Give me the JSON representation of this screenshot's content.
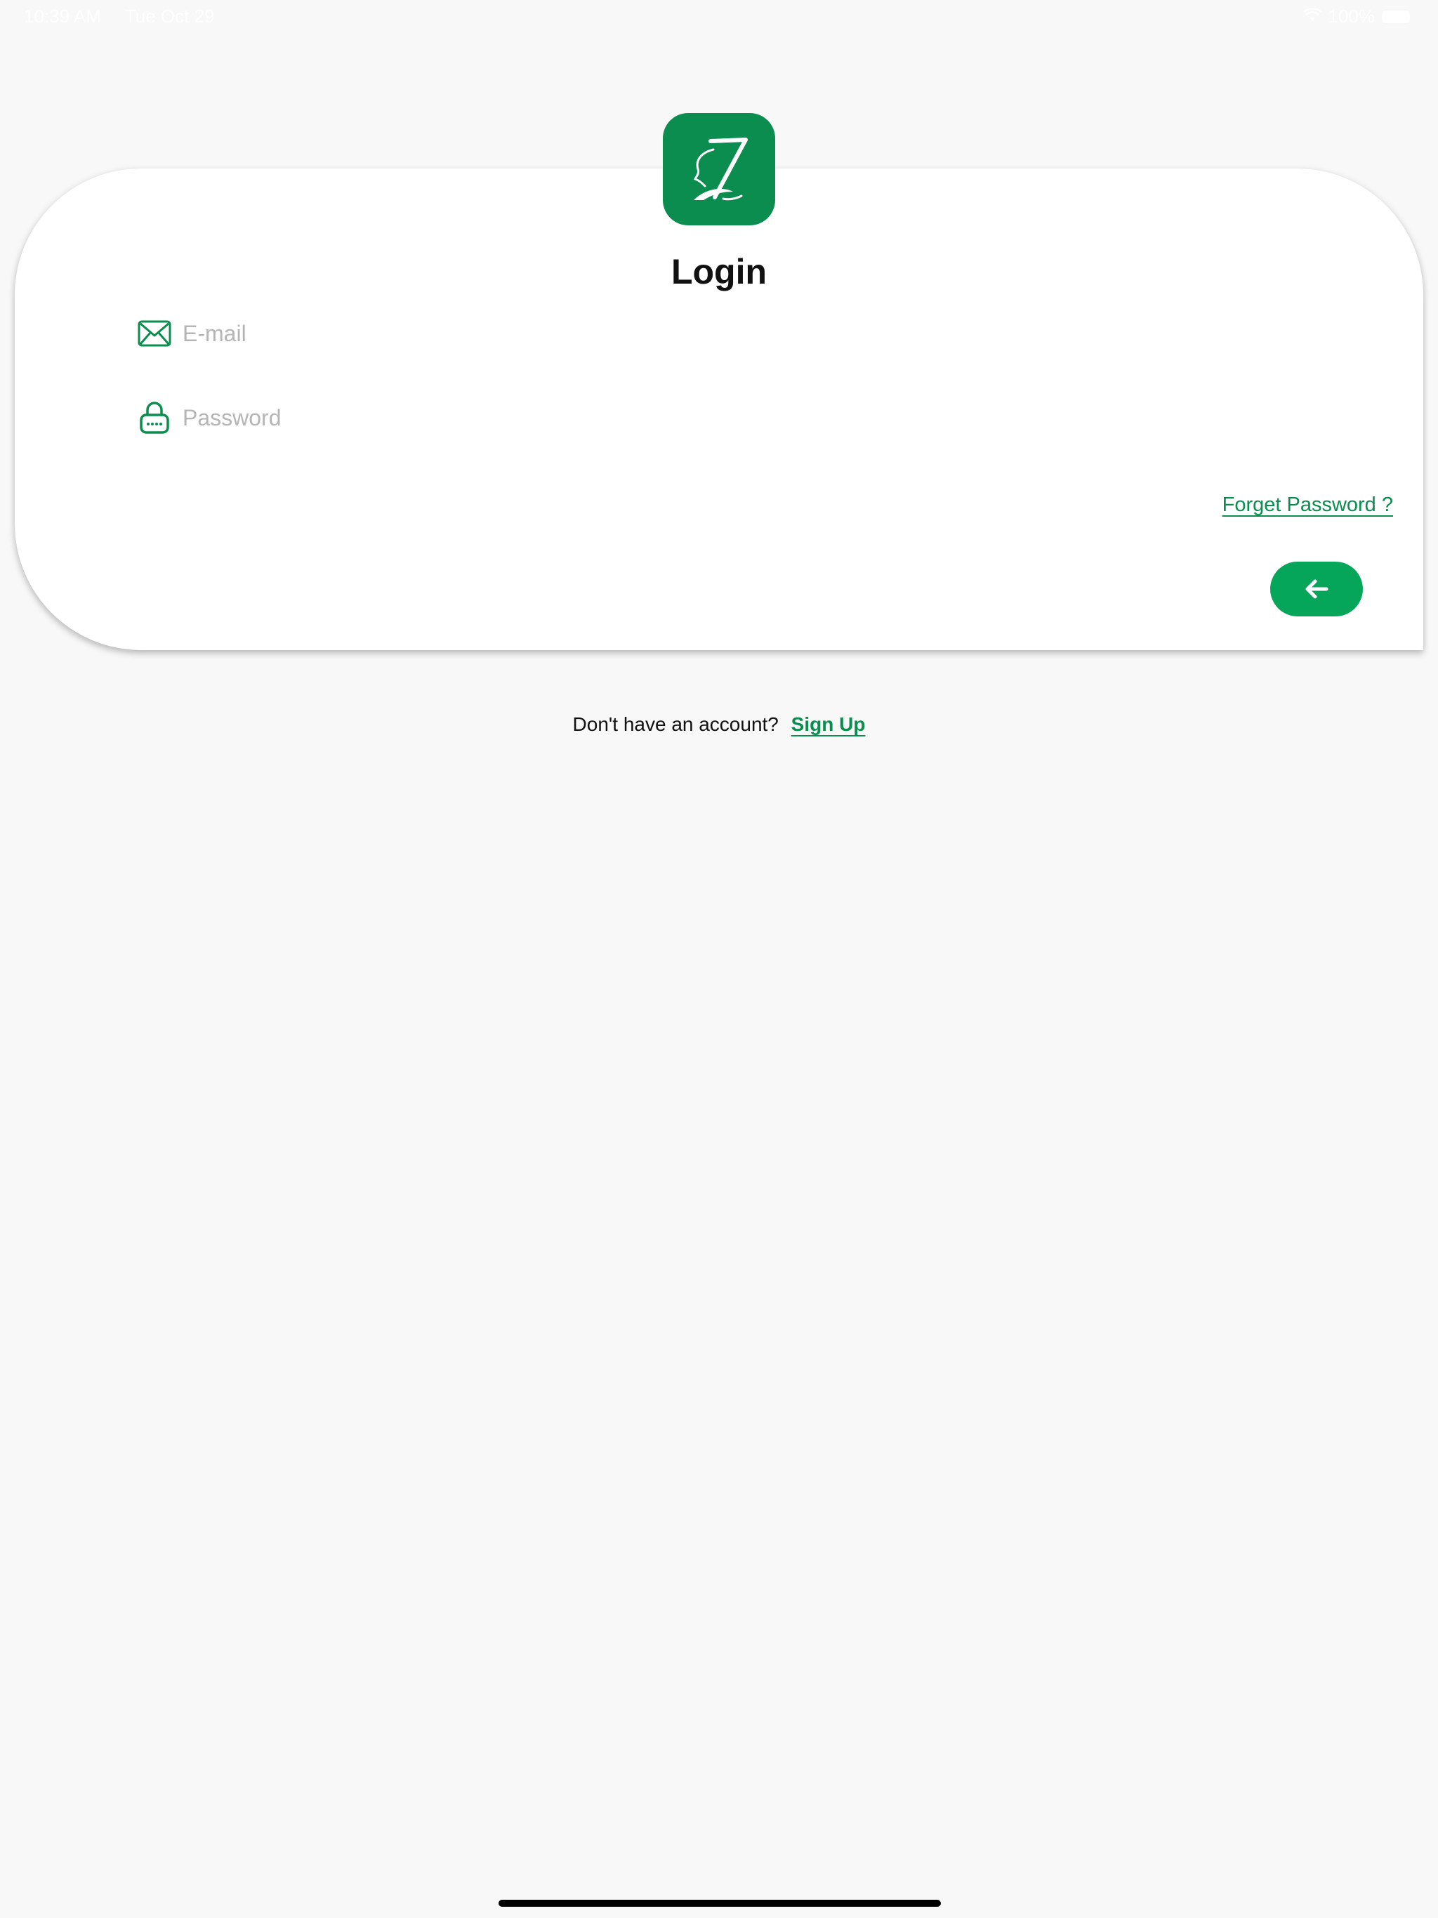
{
  "status_bar": {
    "time": "10:39 AM",
    "date": "Tue Oct 29",
    "battery": "100%"
  },
  "app": {
    "brand_color": "#0a8d4e",
    "button_color": "#06a65a"
  },
  "login": {
    "title": "Login",
    "email_placeholder": "E-mail",
    "email_value": "",
    "password_placeholder": "Password",
    "password_value": "",
    "forgot_password": "Forget Password ?",
    "submit_icon": "arrow-left-icon"
  },
  "footer": {
    "prompt": "Don't have an account?",
    "signup": "Sign Up"
  }
}
